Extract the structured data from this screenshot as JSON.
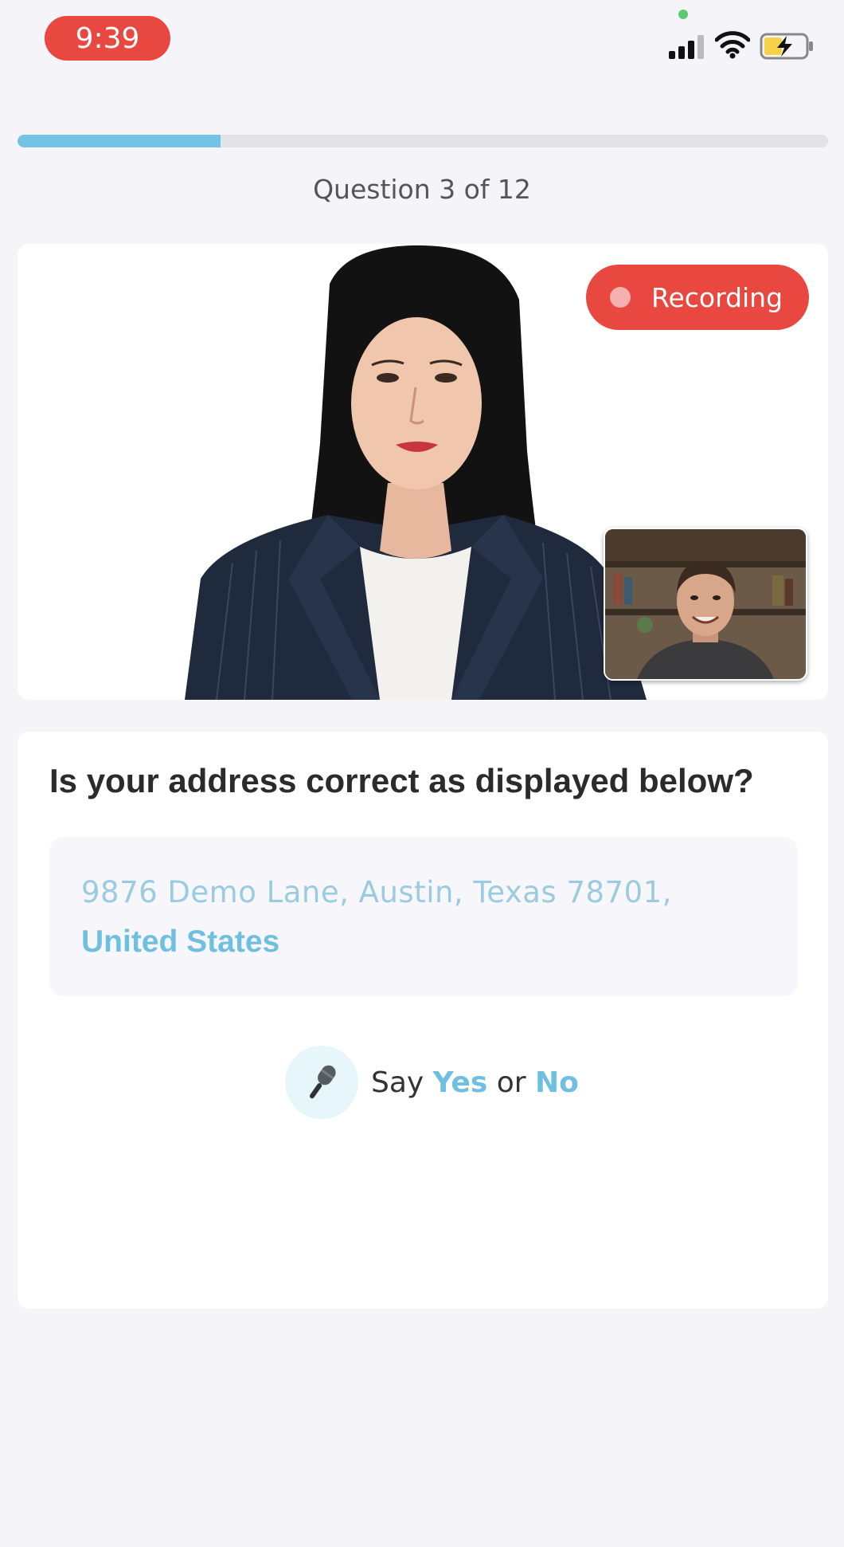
{
  "status_bar": {
    "time": "9:39",
    "icons": [
      "signal-icon",
      "wifi-icon",
      "battery-charging-icon"
    ]
  },
  "progress": {
    "current": 3,
    "total": 12,
    "fraction": 0.25,
    "label": "Question 3 of 12"
  },
  "video": {
    "recording_label": "Recording",
    "agent": "interviewer-avatar",
    "self_view": "user-camera-preview"
  },
  "question": {
    "title": "Is your address correct as displayed below?",
    "address_line1": "9876 Demo Lane, Austin, Texas 78701,",
    "address_line2": "United States"
  },
  "voice_prompt": {
    "say": "Say",
    "yes": "Yes",
    "or": "or",
    "no": "No",
    "icon": "microphone-icon"
  },
  "colors": {
    "accent": "#74c3e6",
    "recording": "#e8483f",
    "background": "#f5f4f8"
  }
}
